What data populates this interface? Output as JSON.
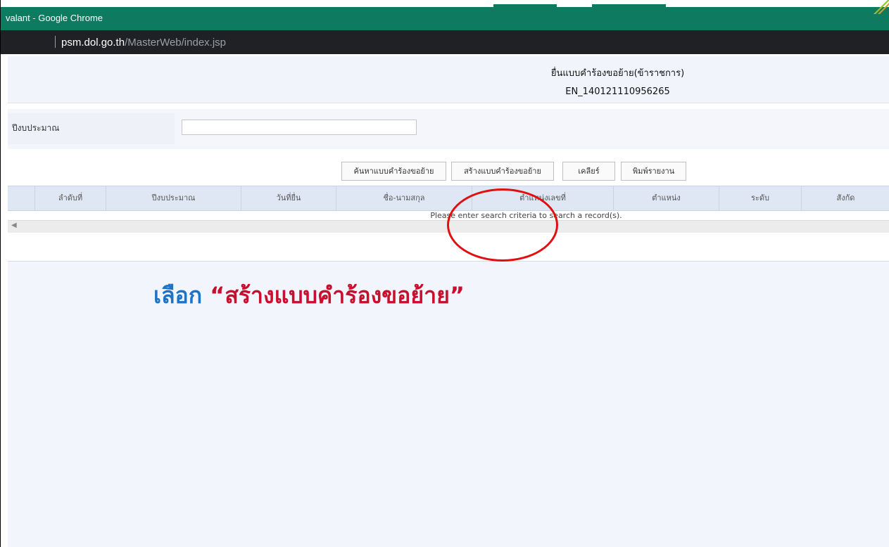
{
  "browser": {
    "window_title": "valant - Google Chrome",
    "url_host": "psm.dol.go.th",
    "url_path": "/MasterWeb/index.jsp"
  },
  "page": {
    "header_title": "ยื่นแบบคำร้องขอย้าย(ข้าราชการ)",
    "header_code": "EN_140121110956265"
  },
  "filter": {
    "budget_year_label": "ปีงบประมาณ",
    "budget_year_value": ""
  },
  "buttons": {
    "search": "ค้นหาแบบคำร้องขอย้าย",
    "create": "สร้างแบบคำร้องขอย้าย",
    "clear": "เคลียร์",
    "print": "พิมพ์รายงาน"
  },
  "grid": {
    "columns": [
      "ลำดับที่",
      "ปีงบประมาณ",
      "วันที่ยื่น",
      "ชื่อ-นามสกุล",
      "ตำแหน่งเลขที่",
      "ตำแหน่ง",
      "ระดับ",
      "สังกัด"
    ],
    "empty_message": "Please enter search criteria to search a record(s)."
  },
  "annotation": {
    "prefix": "เลือก",
    "quote_open": "“",
    "highlight": "สร้างแบบคำร้องขอย้าย",
    "quote_close": "”",
    "prefix_color": "#1f73c7",
    "highlight_color": "#c8102e",
    "circle_color": "#e01010"
  },
  "colors": {
    "titlebar": "#0e7a5f",
    "addressbar": "#202124",
    "grid_header": "#dfe7f4",
    "page_bg": "#f2f6fc"
  }
}
